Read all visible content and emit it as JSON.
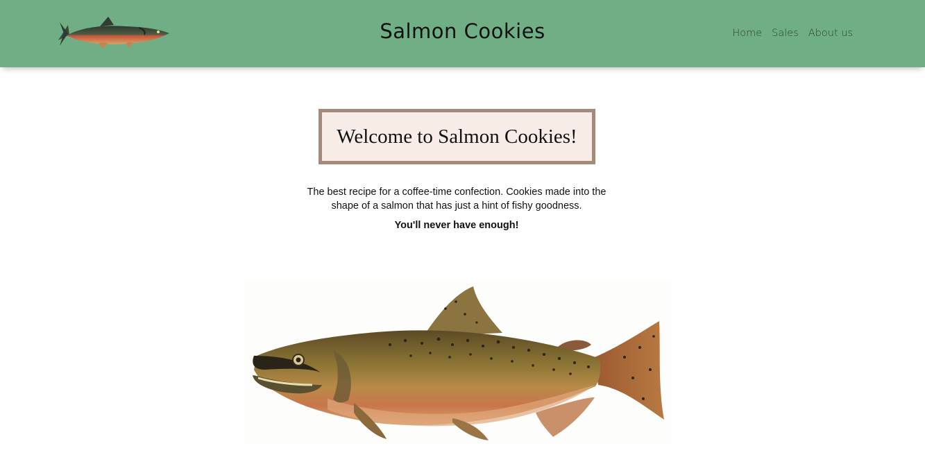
{
  "header": {
    "logo_icon": "salmon-logo-icon",
    "title": "Salmon Cookies",
    "nav": [
      {
        "label": "Home"
      },
      {
        "label": "Sales"
      },
      {
        "label": "About us"
      }
    ],
    "background_color": "#70af85"
  },
  "main": {
    "welcome_heading": "Welcome to Salmon Cookies!",
    "intro_text": "The best recipe for a coffee-time confection. Cookies made into the shape of a salmon that has just a hint of fishy goodness.",
    "tagline": "You'll never have enough!",
    "hero_image_icon": "salmon-illustration",
    "welcome_box_background": "#f7ede6",
    "welcome_box_border": "#a58a79"
  }
}
